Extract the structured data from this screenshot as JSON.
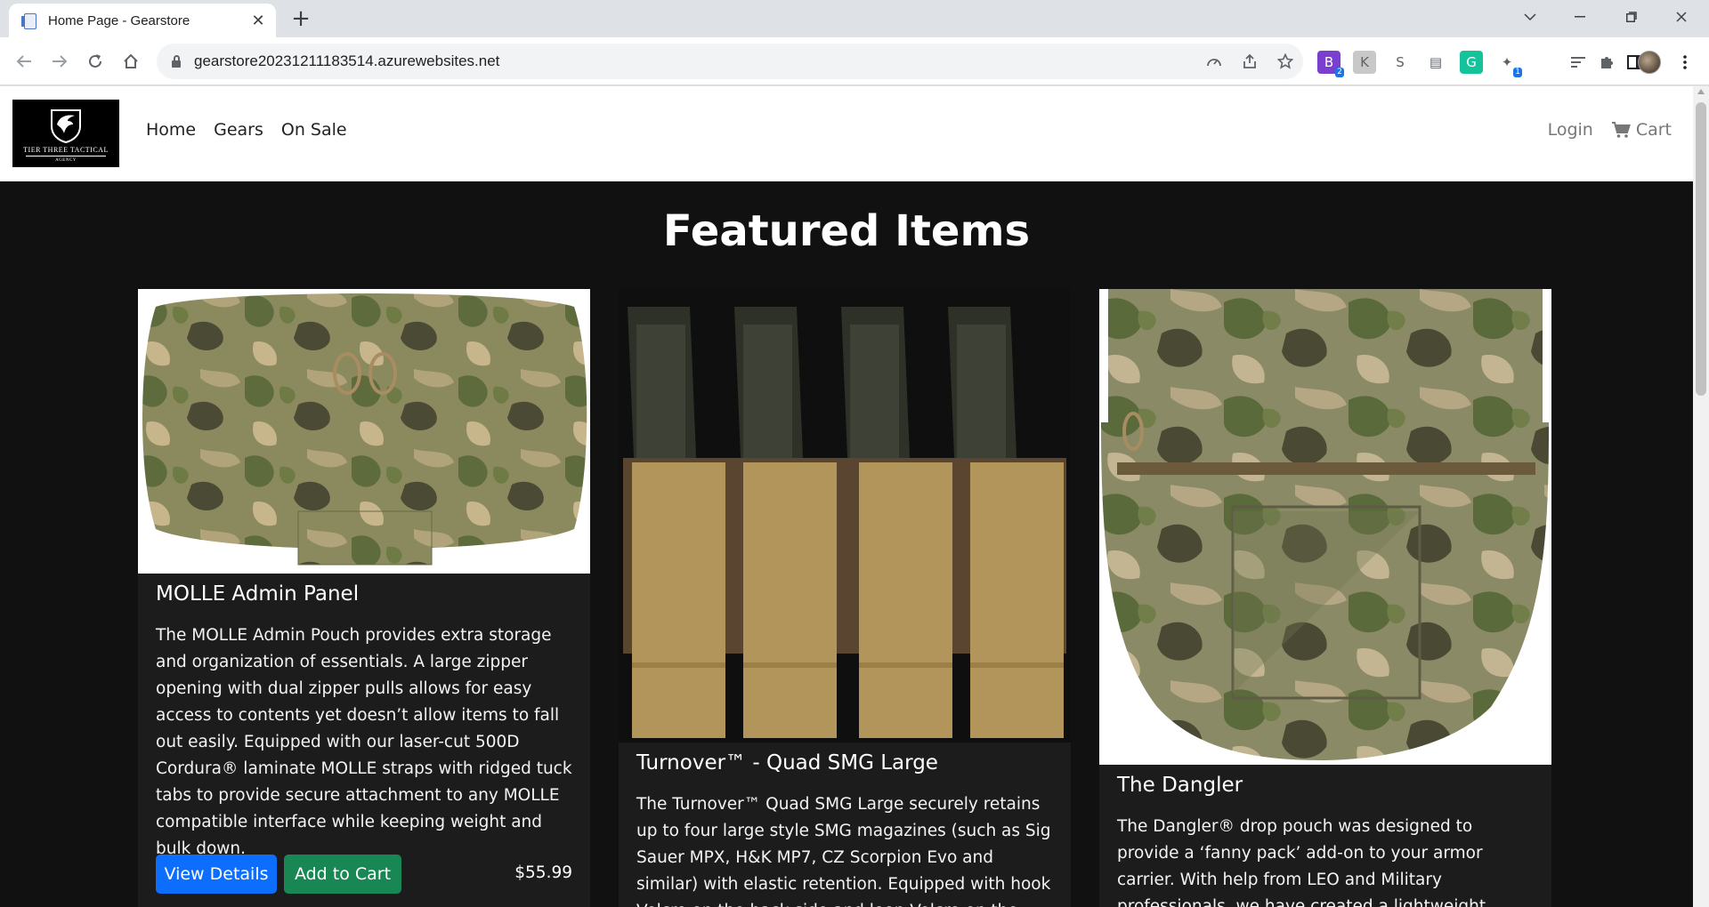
{
  "browser": {
    "tab_title": "Home Page - Gearstore",
    "url": "gearstore20231211183514.azurewebsites.net",
    "extensions": [
      {
        "name": "ext-1",
        "glyph": "B",
        "badge": "2",
        "color": "#7b3fcf"
      },
      {
        "name": "ext-2",
        "glyph": "K",
        "badge": "",
        "color": "#c8c8c8"
      },
      {
        "name": "ext-3",
        "glyph": "S",
        "badge": "",
        "color": "#ffffff"
      },
      {
        "name": "ext-4",
        "glyph": "▤",
        "badge": "",
        "color": "#ffffff"
      },
      {
        "name": "ext-5",
        "glyph": "G",
        "badge": "",
        "color": "#15c39a"
      },
      {
        "name": "ext-6",
        "glyph": "✦",
        "badge": "1",
        "color": "#ffffff"
      }
    ]
  },
  "site": {
    "logo_text": "TIER THREE TACTICAL",
    "logo_subtext": "AGENCY",
    "nav": {
      "home": "Home",
      "gears": "Gears",
      "on_sale": "On Sale",
      "login": "Login",
      "cart": "Cart"
    },
    "hero_title": "Featured Items",
    "products": [
      {
        "name": "MOLLE Admin Panel",
        "description": "The MOLLE Admin Pouch provides extra storage and organization of essentials. A large zipper opening with dual zipper pulls allows for easy access to contents yet doesn’t allow items to fall out easily. Equipped with our laser-cut 500D Cordura® laminate MOLLE straps with ridged tuck tabs to provide secure attachment to any MOLLE compatible interface while keeping weight and bulk down.",
        "view_details": "View Details",
        "add_to_cart": "Add to Cart",
        "price": "$55.99"
      },
      {
        "name": "Turnover™ - Quad SMG Large",
        "description": "The Turnover™ Quad SMG Large securely retains up to four large style SMG magazines (such as Sig Sauer MPX, H&K MP7, CZ Scorpion Evo and similar) with elastic retention. Equipped with hook Velcro on the back side and loop Velcro on the front. Designed"
      },
      {
        "name": "The Dangler",
        "description": "The Dangler® drop pouch was designed to provide a ‘fanny pack’ add-on to your armor carrier. With help from LEO and Military professionals, we have created a lightweight, durable and flexible tool"
      }
    ]
  },
  "colors": {
    "page_bg": "#111111",
    "card_bg": "#1c1c1c",
    "primary": "#0d6efd",
    "success": "#198754"
  }
}
